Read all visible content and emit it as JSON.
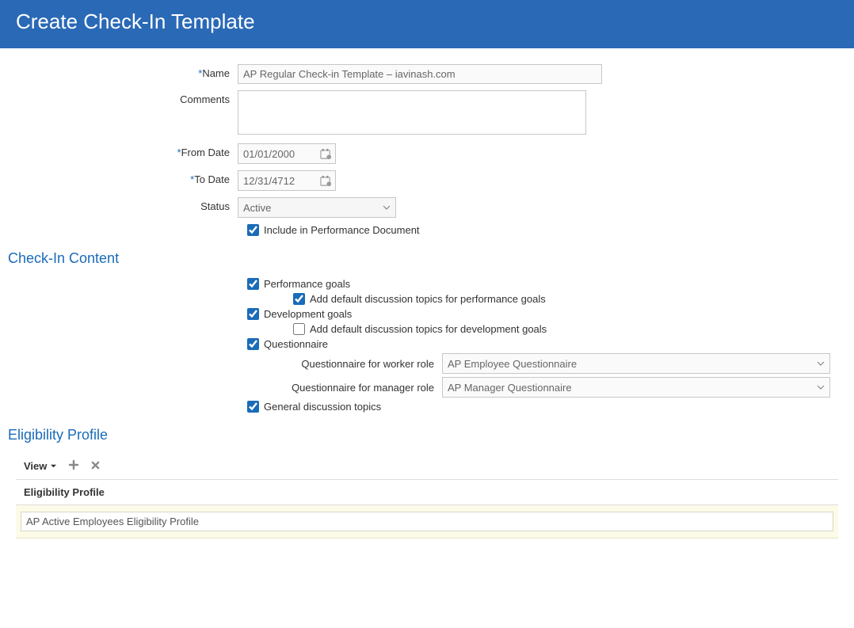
{
  "header": {
    "title": "Create Check-In Template"
  },
  "form": {
    "name_label": "Name",
    "name_value": "AP Regular Check-in Template – iavinash.com",
    "comments_label": "Comments",
    "comments_value": "",
    "from_date_label": "From Date",
    "from_date_value": "01/01/2000",
    "to_date_label": "To Date",
    "to_date_value": "12/31/4712",
    "status_label": "Status",
    "status_value": "Active",
    "include_perf_doc_label": "Include in Performance Document"
  },
  "sections": {
    "checkin_content": "Check-In Content",
    "eligibility_profile": "Eligibility Profile"
  },
  "content": {
    "perf_goals": "Performance goals",
    "perf_goals_default": "Add default discussion topics for performance goals",
    "dev_goals": "Development goals",
    "dev_goals_default": "Add default discussion topics for development goals",
    "questionnaire": "Questionnaire",
    "q_worker_label": "Questionnaire for worker role",
    "q_worker_value": "AP Employee Questionnaire",
    "q_manager_label": "Questionnaire for manager role",
    "q_manager_value": "AP Manager Questionnaire",
    "general_topics": "General discussion topics"
  },
  "toolbar": {
    "view_label": "View"
  },
  "table": {
    "header": "Eligibility Profile",
    "row1_value": "AP Active Employees Eligibility Profile"
  }
}
